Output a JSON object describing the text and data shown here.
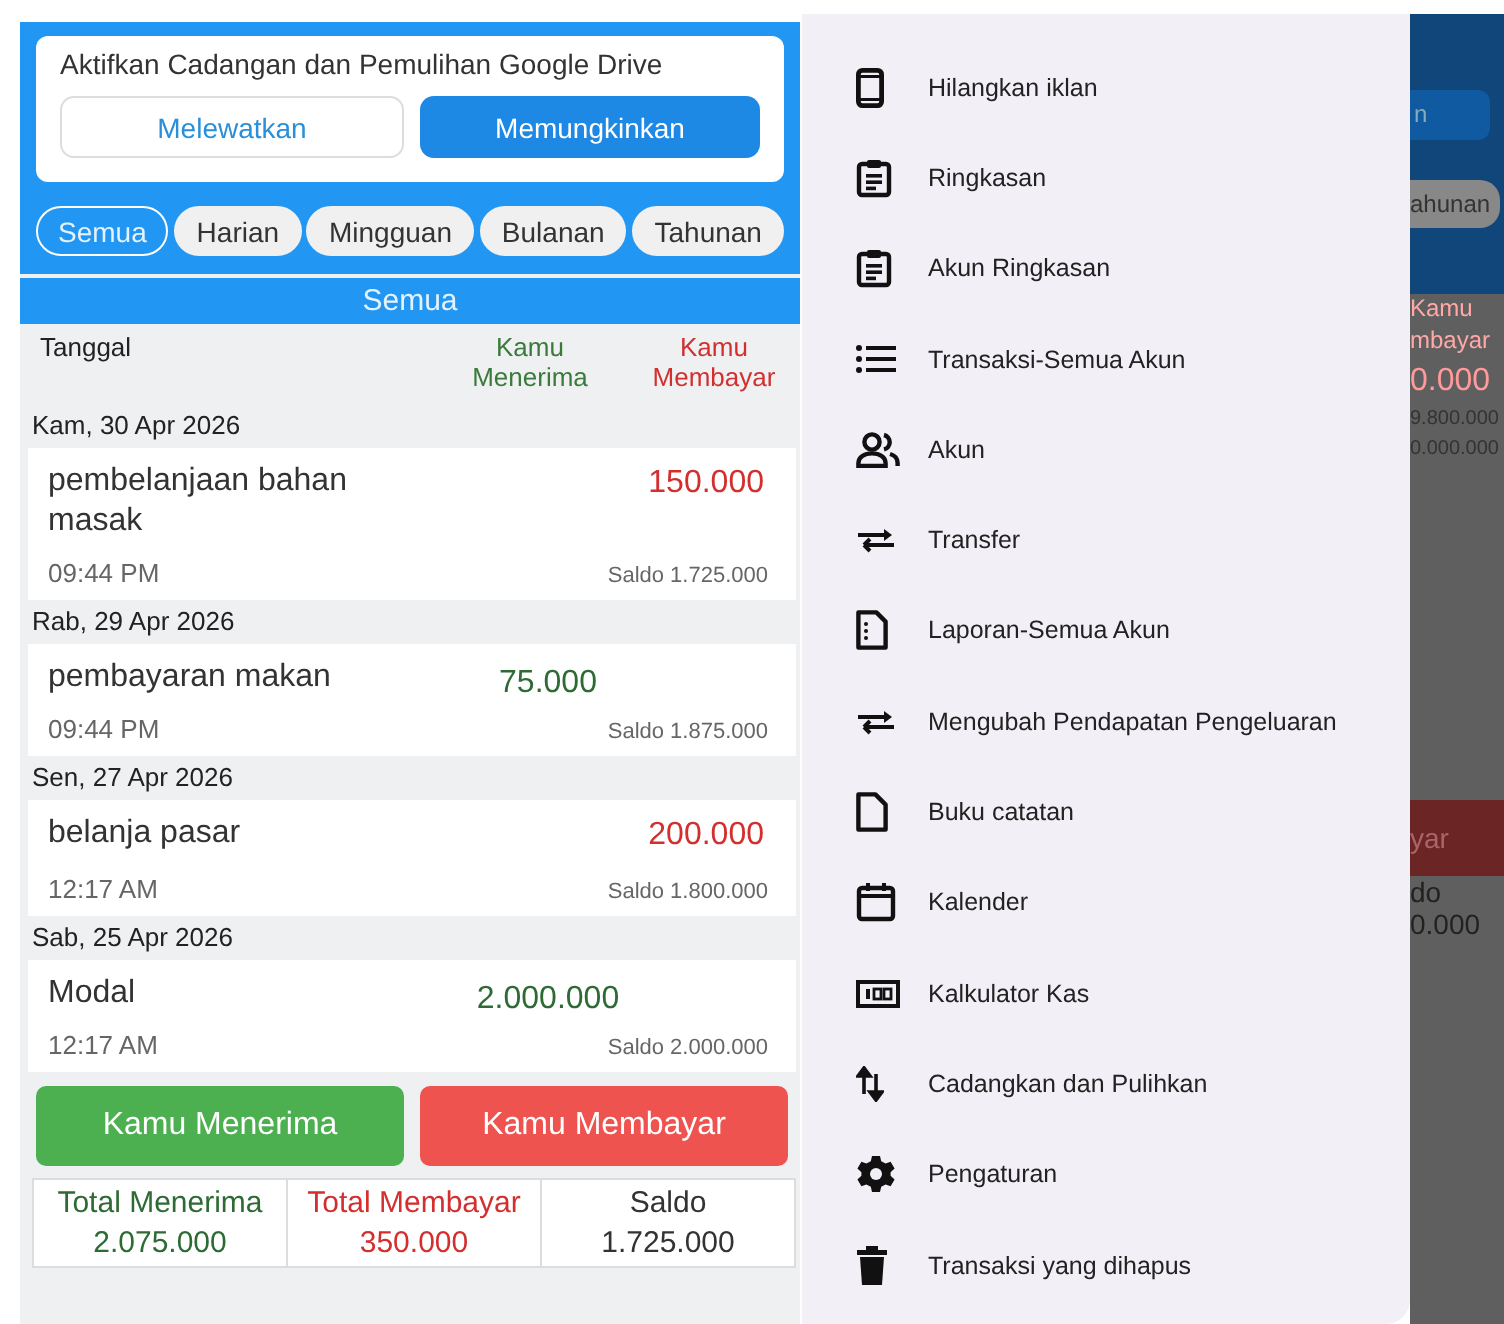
{
  "backup_prompt": {
    "message": "Aktifkan Cadangan dan Pemulihan Google Drive",
    "buttons": [
      {
        "label": "Melewatkan",
        "kind": "secondary"
      },
      {
        "label": "Memungkinkan",
        "kind": "primary"
      }
    ]
  },
  "period_filters": [
    {
      "label": "Semua",
      "selected": true
    },
    {
      "label": "Harian",
      "selected": false
    },
    {
      "label": "Mingguan",
      "selected": false
    },
    {
      "label": "Bulanan",
      "selected": false
    },
    {
      "label": "Tahunan",
      "selected": false
    }
  ],
  "list_title": "Semua",
  "columns": [
    "Tanggal",
    "Kamu Menerima",
    "Kamu Membayar"
  ],
  "groups": [
    {
      "date": "Kam, 30 Apr 2026",
      "transactions": [
        {
          "description": "pembelanjaan bahan masak",
          "time": "09:44 PM",
          "kind": "expense",
          "amount": "150.000",
          "balance": "Saldo 1.725.000"
        }
      ]
    },
    {
      "date": "Rab, 29 Apr 2026",
      "transactions": [
        {
          "description": "pembayaran makan",
          "time": "09:44 PM",
          "kind": "income",
          "amount": "75.000",
          "balance": "Saldo 1.875.000"
        }
      ]
    },
    {
      "date": "Sen, 27 Apr 2026",
      "transactions": [
        {
          "description": "belanja pasar",
          "time": "12:17 AM",
          "kind": "expense",
          "amount": "200.000",
          "balance": "Saldo 1.800.000"
        }
      ]
    },
    {
      "date": "Sab, 25 Apr 2026",
      "transactions": [
        {
          "description": "Modal",
          "time": "12:17 AM",
          "kind": "income",
          "amount": "2.000.000",
          "balance": "Saldo 2.000.000"
        }
      ]
    }
  ],
  "actions": [
    {
      "label": "Kamu Menerima",
      "kind": "income"
    },
    {
      "label": "Kamu Membayar",
      "kind": "expense"
    }
  ],
  "totals": [
    {
      "label": "Total Menerima",
      "value": "2.075.000",
      "kind": "income"
    },
    {
      "label": "Total Membayar",
      "value": "350.000",
      "kind": "expense"
    },
    {
      "label": "Saldo",
      "value": "1.725.000",
      "kind": "balance"
    }
  ],
  "drawer": {
    "items": [
      {
        "label": "Hilangkan iklan"
      },
      {
        "label": "Ringkasan"
      },
      {
        "label": "Akun Ringkasan"
      },
      {
        "label": "Transaksi-Semua Akun"
      },
      {
        "label": "Akun"
      },
      {
        "label": "Transfer"
      },
      {
        "label": "Laporan-Semua Akun"
      },
      {
        "label": "Mengubah Pendapatan Pengeluaran"
      },
      {
        "label": "Buku catatan"
      },
      {
        "label": "Kalender"
      },
      {
        "label": "Kalkulator Kas"
      },
      {
        "label": "Cadangkan dan Pulihkan"
      },
      {
        "label": "Pengaturan"
      },
      {
        "label": "Transaksi yang dihapus"
      }
    ]
  },
  "background_fragments": [
    {
      "text": "n",
      "kind": "button"
    },
    {
      "text": "ahunan",
      "kind": "chip"
    },
    {
      "text": "Kamu mbayar",
      "kind": "header"
    },
    {
      "text": "0.000",
      "kind": "amount"
    },
    {
      "text": "9.800.000",
      "kind": "balance"
    },
    {
      "text": "0.000.000",
      "kind": "balance"
    },
    {
      "text": "yar",
      "kind": "action"
    },
    {
      "text": "do",
      "kind": "total"
    },
    {
      "text": "0.000",
      "kind": "total"
    }
  ]
}
